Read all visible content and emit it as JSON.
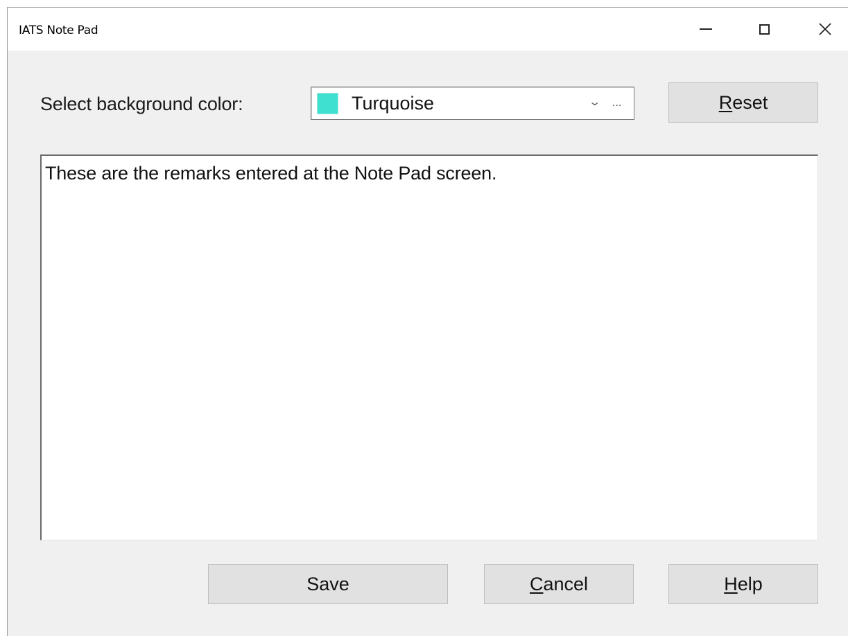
{
  "window": {
    "title": "IATS Note Pad"
  },
  "titlebar": {
    "minimize_icon": "minimize-icon",
    "maximize_icon": "maximize-icon",
    "close_icon": "close-icon"
  },
  "background_color": {
    "label": "Select background color:",
    "selected_value": "Turquoise",
    "swatch_color": "#40e0d0",
    "dropdown_arrow": "⌄",
    "ellipsis": "..."
  },
  "buttons": {
    "reset": {
      "mnemonic": "R",
      "rest": "eset"
    },
    "save": {
      "label": "Save"
    },
    "cancel": {
      "mnemonic": "C",
      "rest": "ancel"
    },
    "help": {
      "mnemonic": "H",
      "rest": "elp"
    }
  },
  "notes": {
    "text": "These are the remarks entered at the Note Pad screen."
  },
  "colors": {
    "window_background": "#f0f0f0",
    "button_face": "#e1e1e1",
    "text_area_background": "#ffffff"
  }
}
